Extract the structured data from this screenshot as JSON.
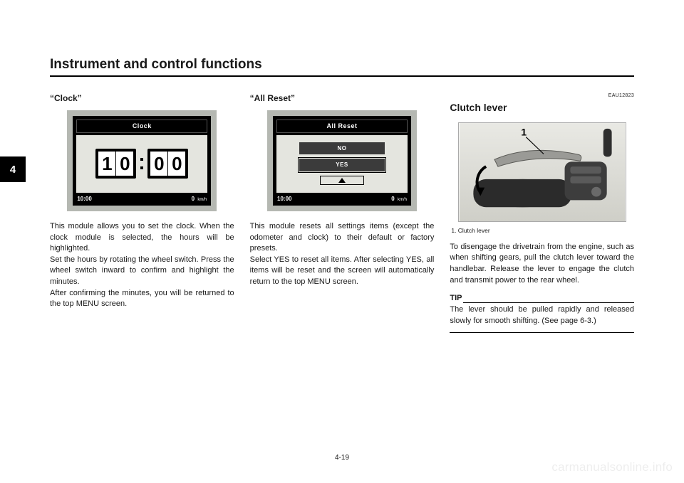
{
  "header": "Instrument and control functions",
  "side_tab": "4",
  "page_number": "4-19",
  "watermark": "carmanualsonline.info",
  "col1": {
    "subhead": "“Clock”",
    "display": {
      "title": "Clock",
      "hours": [
        "1",
        "0"
      ],
      "minutes": [
        "0",
        "0"
      ],
      "status_left": "10:00",
      "status_right_value": "0",
      "status_right_unit": "km/h"
    },
    "p1": "This module allows you to set the clock. When the clock module is selected, the hours will be highlighted.",
    "p2": "Set the hours by rotating the wheel switch. Press the wheel switch inward to confirm and highlight the minutes.",
    "p3": "After confirming the minutes, you will be returned to the top MENU screen."
  },
  "col2": {
    "subhead": "“All Reset”",
    "display": {
      "title": "All Reset",
      "option_no": "NO",
      "option_yes": "YES",
      "status_left": "10:00",
      "status_right_value": "0",
      "status_right_unit": "km/h"
    },
    "p1": "This module resets all settings items (except the odometer and clock) to their default or factory presets.",
    "p2": "Select YES to reset all items. After selecting YES, all items will be reset and the screen will automatically return to the top MENU screen."
  },
  "col3": {
    "eau": "EAU12823",
    "title": "Clutch lever",
    "photo_label": "1",
    "caption": "1.  Clutch lever",
    "p1": "To disengage the drivetrain from the engine, such as when shifting gears, pull the clutch lever toward the handlebar. Release the lever to engage the clutch and transmit power to the rear wheel.",
    "tip_head": "TIP",
    "tip_body": "The lever should be pulled rapidly and released slowly for smooth shifting. (See page 6-3.)"
  }
}
